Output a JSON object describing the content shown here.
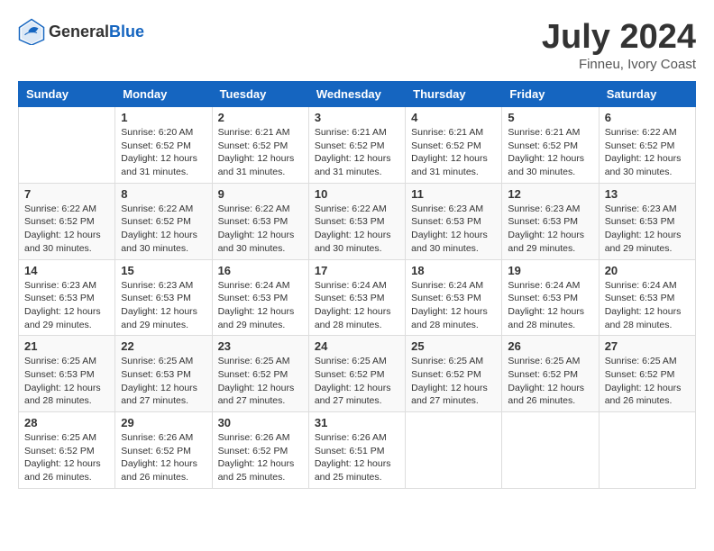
{
  "header": {
    "logo_general": "General",
    "logo_blue": "Blue",
    "title": "July 2024",
    "location": "Finneu, Ivory Coast"
  },
  "calendar": {
    "weekdays": [
      "Sunday",
      "Monday",
      "Tuesday",
      "Wednesday",
      "Thursday",
      "Friday",
      "Saturday"
    ],
    "weeks": [
      [
        {
          "day": "",
          "info": ""
        },
        {
          "day": "1",
          "info": "Sunrise: 6:20 AM\nSunset: 6:52 PM\nDaylight: 12 hours and 31 minutes."
        },
        {
          "day": "2",
          "info": "Sunrise: 6:21 AM\nSunset: 6:52 PM\nDaylight: 12 hours and 31 minutes."
        },
        {
          "day": "3",
          "info": "Sunrise: 6:21 AM\nSunset: 6:52 PM\nDaylight: 12 hours and 31 minutes."
        },
        {
          "day": "4",
          "info": "Sunrise: 6:21 AM\nSunset: 6:52 PM\nDaylight: 12 hours and 31 minutes."
        },
        {
          "day": "5",
          "info": "Sunrise: 6:21 AM\nSunset: 6:52 PM\nDaylight: 12 hours and 30 minutes."
        },
        {
          "day": "6",
          "info": "Sunrise: 6:22 AM\nSunset: 6:52 PM\nDaylight: 12 hours and 30 minutes."
        }
      ],
      [
        {
          "day": "7",
          "info": "Sunrise: 6:22 AM\nSunset: 6:52 PM\nDaylight: 12 hours and 30 minutes."
        },
        {
          "day": "8",
          "info": "Sunrise: 6:22 AM\nSunset: 6:52 PM\nDaylight: 12 hours and 30 minutes."
        },
        {
          "day": "9",
          "info": "Sunrise: 6:22 AM\nSunset: 6:53 PM\nDaylight: 12 hours and 30 minutes."
        },
        {
          "day": "10",
          "info": "Sunrise: 6:22 AM\nSunset: 6:53 PM\nDaylight: 12 hours and 30 minutes."
        },
        {
          "day": "11",
          "info": "Sunrise: 6:23 AM\nSunset: 6:53 PM\nDaylight: 12 hours and 30 minutes."
        },
        {
          "day": "12",
          "info": "Sunrise: 6:23 AM\nSunset: 6:53 PM\nDaylight: 12 hours and 29 minutes."
        },
        {
          "day": "13",
          "info": "Sunrise: 6:23 AM\nSunset: 6:53 PM\nDaylight: 12 hours and 29 minutes."
        }
      ],
      [
        {
          "day": "14",
          "info": "Sunrise: 6:23 AM\nSunset: 6:53 PM\nDaylight: 12 hours and 29 minutes."
        },
        {
          "day": "15",
          "info": "Sunrise: 6:23 AM\nSunset: 6:53 PM\nDaylight: 12 hours and 29 minutes."
        },
        {
          "day": "16",
          "info": "Sunrise: 6:24 AM\nSunset: 6:53 PM\nDaylight: 12 hours and 29 minutes."
        },
        {
          "day": "17",
          "info": "Sunrise: 6:24 AM\nSunset: 6:53 PM\nDaylight: 12 hours and 28 minutes."
        },
        {
          "day": "18",
          "info": "Sunrise: 6:24 AM\nSunset: 6:53 PM\nDaylight: 12 hours and 28 minutes."
        },
        {
          "day": "19",
          "info": "Sunrise: 6:24 AM\nSunset: 6:53 PM\nDaylight: 12 hours and 28 minutes."
        },
        {
          "day": "20",
          "info": "Sunrise: 6:24 AM\nSunset: 6:53 PM\nDaylight: 12 hours and 28 minutes."
        }
      ],
      [
        {
          "day": "21",
          "info": "Sunrise: 6:25 AM\nSunset: 6:53 PM\nDaylight: 12 hours and 28 minutes."
        },
        {
          "day": "22",
          "info": "Sunrise: 6:25 AM\nSunset: 6:53 PM\nDaylight: 12 hours and 27 minutes."
        },
        {
          "day": "23",
          "info": "Sunrise: 6:25 AM\nSunset: 6:52 PM\nDaylight: 12 hours and 27 minutes."
        },
        {
          "day": "24",
          "info": "Sunrise: 6:25 AM\nSunset: 6:52 PM\nDaylight: 12 hours and 27 minutes."
        },
        {
          "day": "25",
          "info": "Sunrise: 6:25 AM\nSunset: 6:52 PM\nDaylight: 12 hours and 27 minutes."
        },
        {
          "day": "26",
          "info": "Sunrise: 6:25 AM\nSunset: 6:52 PM\nDaylight: 12 hours and 26 minutes."
        },
        {
          "day": "27",
          "info": "Sunrise: 6:25 AM\nSunset: 6:52 PM\nDaylight: 12 hours and 26 minutes."
        }
      ],
      [
        {
          "day": "28",
          "info": "Sunrise: 6:25 AM\nSunset: 6:52 PM\nDaylight: 12 hours and 26 minutes."
        },
        {
          "day": "29",
          "info": "Sunrise: 6:26 AM\nSunset: 6:52 PM\nDaylight: 12 hours and 26 minutes."
        },
        {
          "day": "30",
          "info": "Sunrise: 6:26 AM\nSunset: 6:52 PM\nDaylight: 12 hours and 25 minutes."
        },
        {
          "day": "31",
          "info": "Sunrise: 6:26 AM\nSunset: 6:51 PM\nDaylight: 12 hours and 25 minutes."
        },
        {
          "day": "",
          "info": ""
        },
        {
          "day": "",
          "info": ""
        },
        {
          "day": "",
          "info": ""
        }
      ]
    ]
  }
}
